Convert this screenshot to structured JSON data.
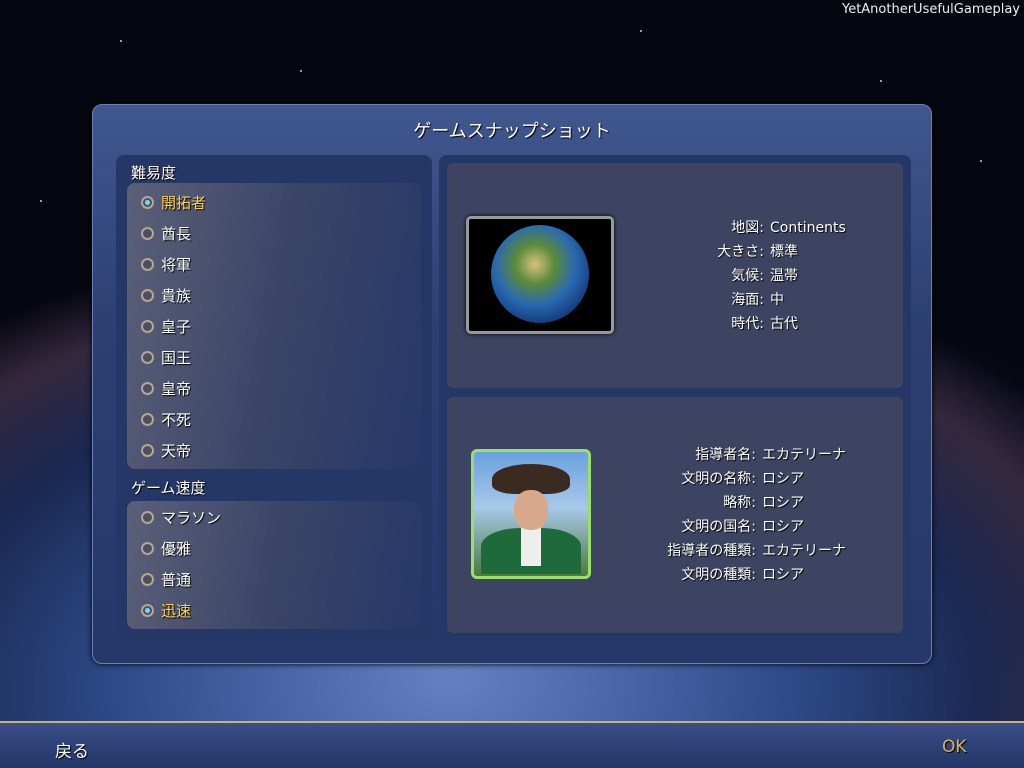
{
  "watermark": "YetAnotherUsefulGameplay",
  "dialog": {
    "title": "ゲームスナップショット"
  },
  "difficulty": {
    "label": "難易度",
    "options": [
      "開拓者",
      "酋長",
      "将軍",
      "貴族",
      "皇子",
      "国王",
      "皇帝",
      "不死",
      "天帝"
    ],
    "selected": "開拓者"
  },
  "speed": {
    "label": "ゲーム速度",
    "options": [
      "マラソン",
      "優雅",
      "普通",
      "迅速"
    ],
    "selected": "迅速"
  },
  "map_info": [
    {
      "k": "地図:",
      "v": "Continents"
    },
    {
      "k": "大きさ:",
      "v": "標準"
    },
    {
      "k": "気候:",
      "v": "温帯"
    },
    {
      "k": "海面:",
      "v": "中"
    },
    {
      "k": "時代:",
      "v": "古代"
    }
  ],
  "leader_info": [
    {
      "k": "指導者名:",
      "v": "エカテリーナ"
    },
    {
      "k": "文明の名称:",
      "v": "ロシア"
    },
    {
      "k": "略称:",
      "v": "ロシア"
    },
    {
      "k": "文明の国名:",
      "v": "ロシア"
    },
    {
      "k": "指導者の種類:",
      "v": "エカテリーナ"
    },
    {
      "k": "文明の種類:",
      "v": "ロシア"
    }
  ],
  "footer": {
    "back": "戻る",
    "ok": "OK"
  },
  "colors": {
    "selected": "#ffd24a",
    "ok": "#d9b24a"
  }
}
